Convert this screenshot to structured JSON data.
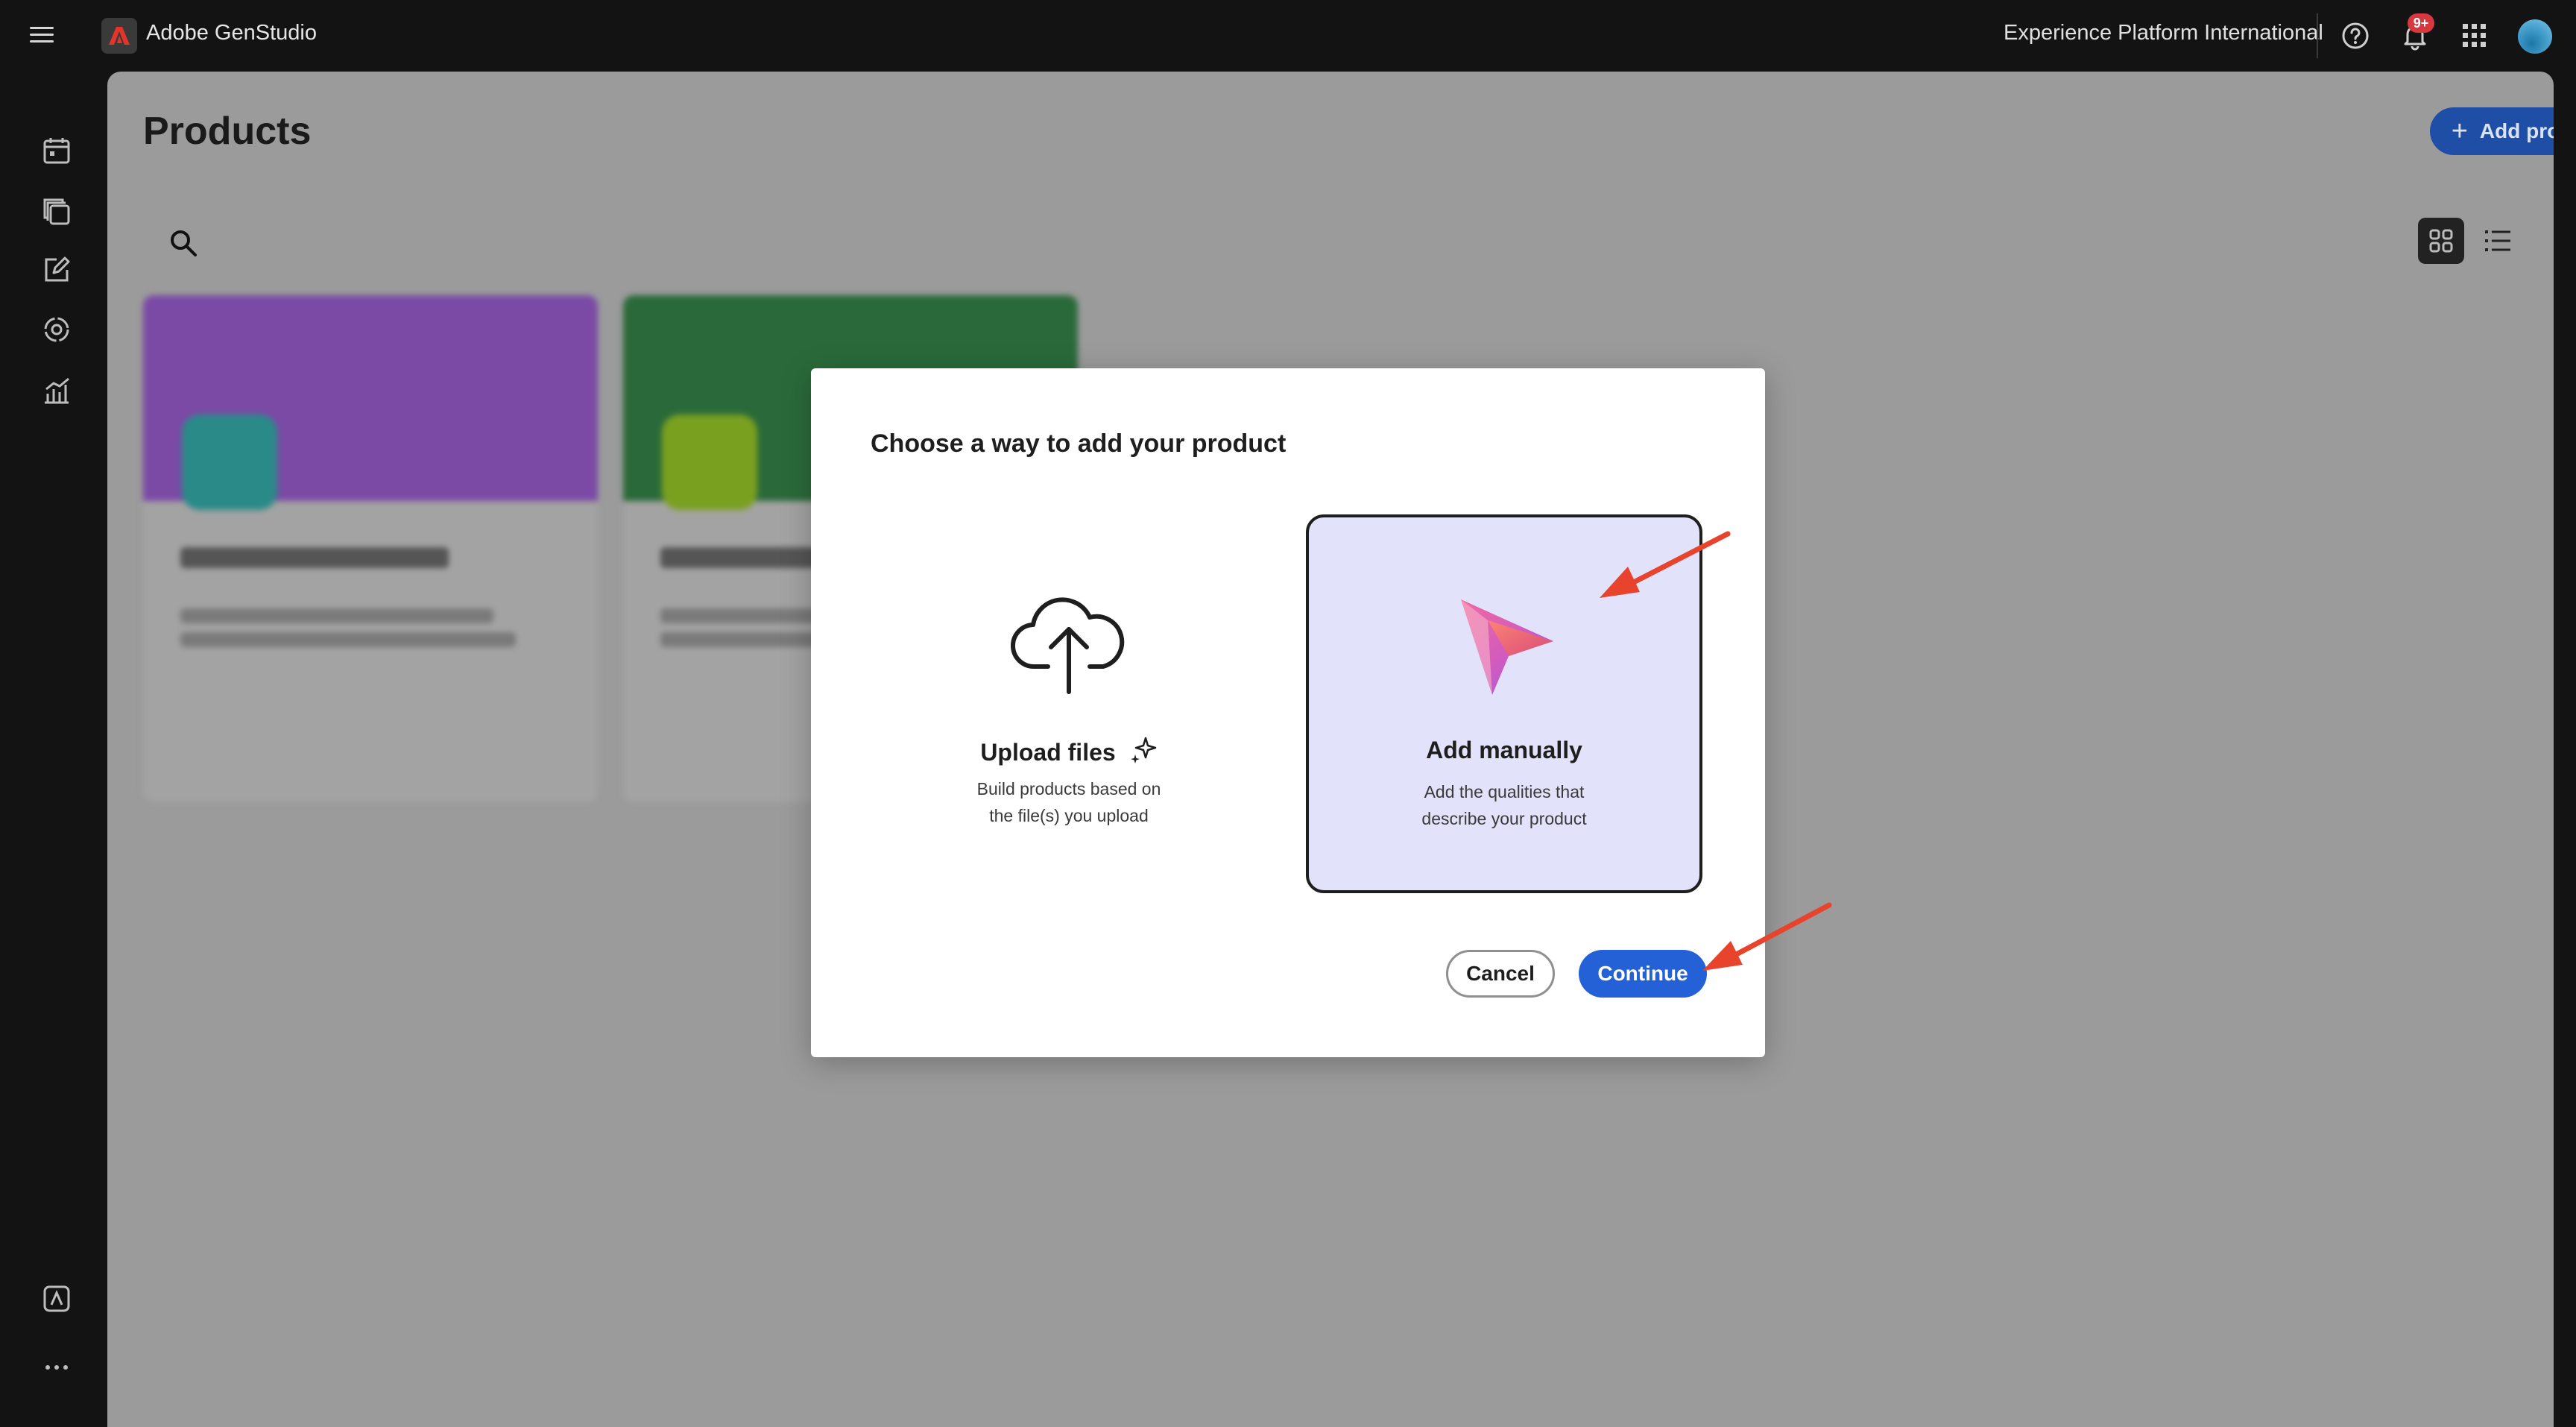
{
  "topbar": {
    "app_name": "Adobe GenStudio",
    "org_name": "Experience Platform International",
    "notification_count": "9+"
  },
  "rail": {
    "icons": [
      "calendar-icon",
      "copy-icon",
      "edit-icon",
      "target-icon",
      "chart-icon",
      "brand-icon",
      "more-icon"
    ]
  },
  "main": {
    "title": "Products",
    "add_product_label": "Add product"
  },
  "cards": [
    {
      "banner_color": "#7a4aa5",
      "thumb_color": "#2a8a88"
    },
    {
      "banner_color": "#2a6a3a",
      "thumb_color": "#7aa020"
    }
  ],
  "dialog": {
    "title": "Choose a way to add your product",
    "options": [
      {
        "title": "Upload files",
        "desc_line1": "Build products based on",
        "desc_line2": "the file(s) you upload",
        "selected": false
      },
      {
        "title": "Add manually",
        "desc_line1": "Add the qualities that",
        "desc_line2": "describe your product",
        "selected": true
      }
    ],
    "cancel_label": "Cancel",
    "continue_label": "Continue"
  },
  "colors": {
    "accent": "#2460d6",
    "annotation": "#e8432c",
    "selected_bg": "#e2e2fa"
  }
}
